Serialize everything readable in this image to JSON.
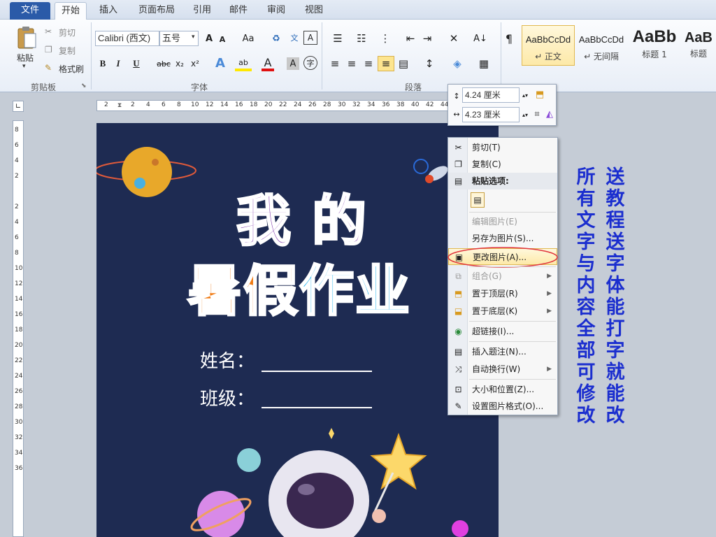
{
  "tabs": [
    "文件",
    "开始",
    "插入",
    "页面布局",
    "引用",
    "邮件",
    "审阅",
    "视图"
  ],
  "ribbon": {
    "clipboard": {
      "paste": "粘贴",
      "cut": "剪切",
      "copy": "复制",
      "format_painter": "格式刷",
      "label": "剪贴板"
    },
    "font": {
      "font_name": "Calibri (西文)",
      "font_size": "五号",
      "grow": "A",
      "shrink": "A",
      "case": "Aa",
      "bold": "B",
      "italic": "I",
      "underline": "U",
      "strike": "abc",
      "subscript": "x₂",
      "superscript": "x²",
      "label": "字体"
    },
    "paragraph": {
      "label": "段落"
    },
    "styles": [
      {
        "sample": "AaBbCcDd",
        "name": "↵ 正文"
      },
      {
        "sample": "AaBbCcDd",
        "name": "↵ 无间隔"
      },
      {
        "sample": "AaBb",
        "name": "标题 1"
      },
      {
        "sample": "AaB",
        "name": "标题"
      }
    ]
  },
  "ruler": {
    "h_ticks": [
      "2",
      "2",
      "4",
      "6",
      "8",
      "10",
      "12",
      "14",
      "16",
      "18",
      "20",
      "22",
      "24",
      "26",
      "28",
      "30",
      "32",
      "34",
      "36",
      "38",
      "40",
      "42",
      "44"
    ],
    "v_ticks": [
      "8",
      "6",
      "4",
      "2",
      "2",
      "4",
      "6",
      "8",
      "10",
      "12",
      "14",
      "16",
      "18",
      "20",
      "22",
      "24",
      "26",
      "28",
      "30",
      "32",
      "34",
      "36"
    ]
  },
  "picture_size": {
    "height": "4.24 厘米",
    "width": "4.23 厘米"
  },
  "context_menu": [
    {
      "icon": "scissors-icon",
      "glyph": "✂",
      "label": "剪切(T)",
      "disabled": false,
      "sub": false
    },
    {
      "icon": "copy-icon",
      "glyph": "❐",
      "label": "复制(C)",
      "disabled": false,
      "sub": false
    },
    {
      "icon": "paste-icon",
      "glyph": "📋",
      "label": "粘贴选项:",
      "disabled": false,
      "sub": false,
      "bold": true
    },
    {
      "icon": "edit-picture-icon",
      "glyph": "",
      "label": "编辑图片(E)",
      "disabled": true,
      "sub": false
    },
    {
      "icon": "",
      "glyph": "",
      "label": "另存为图片(S)...",
      "disabled": false,
      "sub": false
    },
    {
      "icon": "change-picture-icon",
      "glyph": "▣",
      "label": "更改图片(A)...",
      "disabled": false,
      "sub": false,
      "highlight": true
    },
    {
      "icon": "group-icon",
      "glyph": "⧉",
      "label": "组合(G)",
      "disabled": true,
      "sub": true
    },
    {
      "icon": "bring-front-icon",
      "glyph": "⬒",
      "label": "置于顶层(R)",
      "disabled": false,
      "sub": true
    },
    {
      "icon": "send-back-icon",
      "glyph": "⬓",
      "label": "置于底层(K)",
      "disabled": false,
      "sub": true
    },
    {
      "icon": "hyperlink-icon",
      "glyph": "🌐",
      "label": "超链接(I)...",
      "disabled": false,
      "sub": false
    },
    {
      "icon": "caption-icon",
      "glyph": "▤",
      "label": "插入题注(N)...",
      "disabled": false,
      "sub": false
    },
    {
      "icon": "wrap-icon",
      "glyph": "⤨",
      "label": "自动换行(W)",
      "disabled": false,
      "sub": true
    },
    {
      "icon": "size-position-icon",
      "glyph": "⊡",
      "label": "大小和位置(Z)...",
      "disabled": false,
      "sub": false
    },
    {
      "icon": "format-picture-icon",
      "glyph": "✎",
      "label": "设置图片格式(O)...",
      "disabled": false,
      "sub": false
    }
  ],
  "document": {
    "title_line1": "我的",
    "title_line2": [
      "暑",
      "假",
      "作",
      "业"
    ],
    "name_label": "姓名：",
    "class_label": "班级："
  },
  "side_notes": {
    "col1": "送教程 送字体 能打字就能改",
    "col2": "所有文字与内容全部可修改"
  },
  "colors": {
    "page_bg": "#1e2b52",
    "title1": "#7a2fa8",
    "orange": "#f07a12",
    "blue": "#1ab0ee",
    "side_text": "#1b2ecf"
  }
}
